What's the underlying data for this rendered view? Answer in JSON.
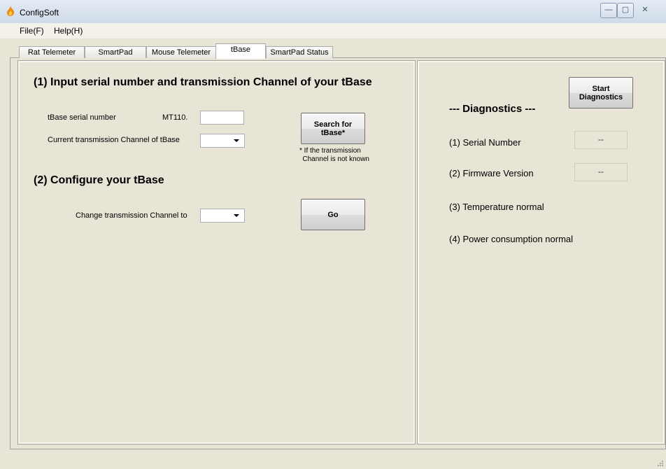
{
  "window": {
    "title": "ConfigSoft",
    "minimize_glyph": "—",
    "maximize_glyph": "▢",
    "close_glyph": "✕"
  },
  "menu": {
    "file": "File(F)",
    "help": "Help(H)"
  },
  "tabs": [
    {
      "label": "Rat Telemeter"
    },
    {
      "label": "SmartPad"
    },
    {
      "label": "Mouse Telemeter"
    },
    {
      "label": "tBase"
    },
    {
      "label": "SmartPad Status"
    }
  ],
  "section1": {
    "heading": "(1) Input serial number and transmission Channel of your tBase",
    "serial_label": "tBase serial number",
    "serial_prefix": "MT110.",
    "serial_value": "",
    "channel_label": "Current transmission Channel of tBase",
    "channel_value": "",
    "search_button": "Search for tBase*",
    "footnote_line1": "* If the transmission",
    "footnote_line2": "Channel is not known"
  },
  "section2": {
    "heading": "(2) Configure your tBase",
    "change_label": "Change transmission Channel to",
    "change_value": "",
    "go_button": "Go"
  },
  "diagnostics": {
    "heading": "--- Diagnostics ---",
    "start_button_line1": "Start",
    "start_button_line2": "Diagnostics",
    "serial_label": "(1) Serial Number",
    "serial_value": "--",
    "firmware_label": "(2) Firmware Version",
    "firmware_value": "--",
    "temperature_label": "(3) Temperature normal",
    "power_label": "(4) Power consumption normal"
  },
  "colors": {
    "background": "#e8e4d6",
    "titlebar": "#d6e1ee",
    "accent_icon": "#e8720c"
  }
}
